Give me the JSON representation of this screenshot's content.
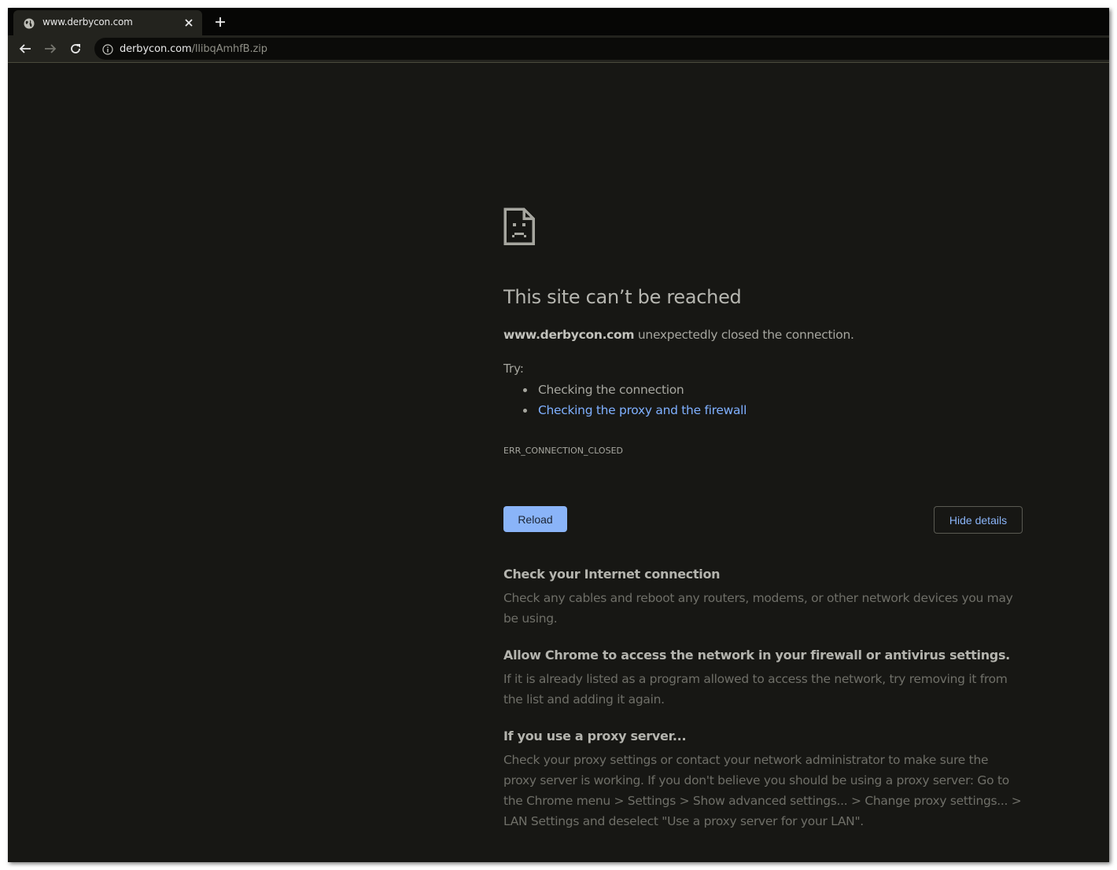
{
  "browser": {
    "tab": {
      "title": "www.derbycon.com",
      "favicon": "globe-icon",
      "close_icon": "close-icon"
    },
    "new_tab_icon": "plus-icon",
    "toolbar": {
      "back_icon": "arrow-left-icon",
      "forward_icon": "arrow-right-icon",
      "reload_icon": "reload-icon",
      "info_icon": "info-icon",
      "url_host": "derbycon.com",
      "url_path": "/llibqAmhfB.zip"
    }
  },
  "error_page": {
    "icon": "sad-document-icon",
    "title": "This site can’t be reached",
    "summary_host": "www.derbycon.com",
    "summary_text": " unexpectedly closed the connection.",
    "try_label": "Try:",
    "suggestions": [
      {
        "text": "Checking the connection",
        "is_link": false
      },
      {
        "text": "Checking the proxy and the firewall",
        "is_link": true
      }
    ],
    "error_code": "ERR_CONNECTION_CLOSED",
    "reload_label": "Reload",
    "details_label": "Hide details",
    "details": [
      {
        "heading": "Check your Internet connection",
        "body": "Check any cables and reboot any routers, modems, or other network devices you may be using."
      },
      {
        "heading": "Allow Chrome to access the network in your firewall or antivirus settings.",
        "body": "If it is already listed as a program allowed to access the network, try removing it from the list and adding it again."
      },
      {
        "heading": "If you use a proxy server...",
        "body": "Check your proxy settings or contact your network administrator to make sure the proxy server is working. If you don't believe you should be using a proxy server: Go to the Chrome menu > Settings > Show advanced settings... > Change proxy settings... > LAN Settings and deselect \"Use a proxy server for your LAN\"."
      }
    ]
  },
  "colors": {
    "page_background": "#171714",
    "toolbar": "#23231e",
    "link": "#7fb0ff",
    "button_primary": "#8ab4f8"
  }
}
